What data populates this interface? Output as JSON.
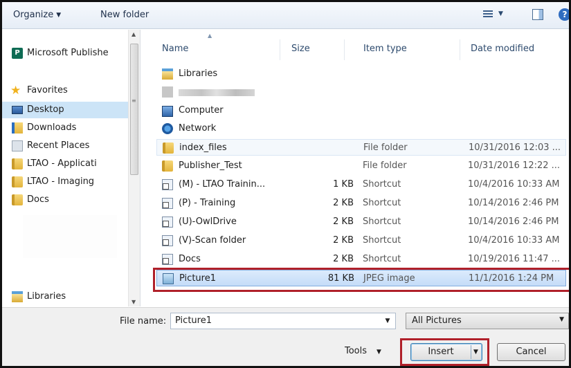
{
  "toolbar": {
    "organize_label": "Organize",
    "new_folder_label": "New folder",
    "help_glyph": "?"
  },
  "nav": {
    "items": [
      {
        "label": "Microsoft Publishe",
        "icon": "publisher-icon"
      },
      {
        "label": "Favorites",
        "icon": "star-icon"
      },
      {
        "label": "Desktop",
        "icon": "desktop-icon",
        "selected": true
      },
      {
        "label": "Downloads",
        "icon": "downloads-folder-icon"
      },
      {
        "label": "Recent Places",
        "icon": "recent-places-icon"
      },
      {
        "label": "LTAO - Applicati",
        "icon": "folder-icon"
      },
      {
        "label": "LTAO - Imaging",
        "icon": "folder-icon"
      },
      {
        "label": "Docs",
        "icon": "folder-icon"
      },
      {
        "label": "Libraries",
        "icon": "libraries-icon"
      }
    ],
    "publisher_glyph": "P"
  },
  "columns": {
    "name": "Name",
    "size": "Size",
    "type": "Item type",
    "date": "Date modified"
  },
  "rows": [
    {
      "name": "Libraries",
      "size": "",
      "type": "",
      "date": "",
      "icon": "libraries-icon"
    },
    {
      "name": "",
      "size": "",
      "type": "",
      "date": "",
      "icon": "blurred-icon"
    },
    {
      "name": "Computer",
      "size": "",
      "type": "",
      "date": "",
      "icon": "computer-icon"
    },
    {
      "name": "Network",
      "size": "",
      "type": "",
      "date": "",
      "icon": "network-icon"
    },
    {
      "name": "index_files",
      "size": "",
      "type": "File folder",
      "date": "10/31/2016 12:03 ...",
      "icon": "folder-icon"
    },
    {
      "name": "Publisher_Test",
      "size": "",
      "type": "File folder",
      "date": "10/31/2016 12:22 ...",
      "icon": "folder-icon"
    },
    {
      "name": "(M) - LTAO Trainin...",
      "size": "1 KB",
      "type": "Shortcut",
      "date": "10/4/2016 10:33 AM",
      "icon": "shortcut-icon"
    },
    {
      "name": "(P) - Training",
      "size": "2 KB",
      "type": "Shortcut",
      "date": "10/14/2016 2:46 PM",
      "icon": "shortcut-icon"
    },
    {
      "name": "(U)-OwlDrive",
      "size": "2 KB",
      "type": "Shortcut",
      "date": "10/14/2016 2:46 PM",
      "icon": "shortcut-icon"
    },
    {
      "name": "(V)-Scan folder",
      "size": "2 KB",
      "type": "Shortcut",
      "date": "10/4/2016 10:33 AM",
      "icon": "shortcut-icon"
    },
    {
      "name": "Docs",
      "size": "2 KB",
      "type": "Shortcut",
      "date": "10/19/2016 11:47 ...",
      "icon": "shortcut-icon"
    },
    {
      "name": "Picture1",
      "size": "81 KB",
      "type": "JPEG image",
      "date": "11/1/2016 1:24 PM",
      "icon": "jpeg-image-icon"
    }
  ],
  "footer": {
    "file_name_label": "File name:",
    "file_name_value": "Picture1",
    "filter_value": "All Pictures",
    "tools_label": "Tools",
    "insert_label": "Insert",
    "cancel_label": "Cancel"
  },
  "colors": {
    "selection_bg": "#cce4f7",
    "highlight_outline": "#b0202a",
    "primary_button_border": "#3c7fb1"
  }
}
